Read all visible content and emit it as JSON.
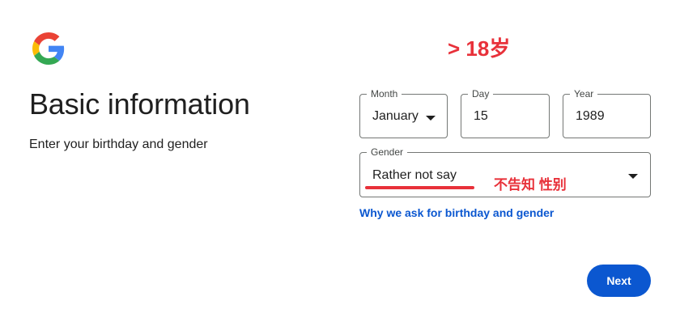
{
  "header": {
    "logo_icon": "google-g-logo-icon",
    "title": "Basic information",
    "subtitle": "Enter your birthday and gender"
  },
  "annotations": {
    "age_note": "> 18岁",
    "gender_note": "不告知 性别",
    "color": "#e8313a"
  },
  "birthday": {
    "month": {
      "label": "Month",
      "value": "January"
    },
    "day": {
      "label": "Day",
      "value": "15"
    },
    "year": {
      "label": "Year",
      "value": "1989"
    }
  },
  "gender": {
    "label": "Gender",
    "value": "Rather not say"
  },
  "links": {
    "why_ask": "Why we ask for birthday and gender"
  },
  "actions": {
    "next_label": "Next"
  },
  "colors": {
    "accent": "#0b57d0",
    "text": "#1f1f1f",
    "border": "#747775"
  }
}
